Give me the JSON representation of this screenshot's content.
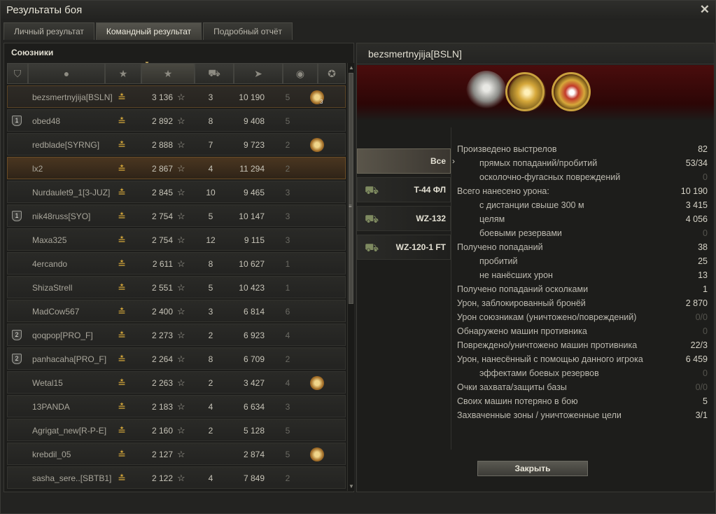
{
  "window": {
    "title": "Результаты боя"
  },
  "tabs": [
    {
      "label": "Личный результат"
    },
    {
      "label": "Командный результат"
    },
    {
      "label": "Подробный отчёт"
    }
  ],
  "left_panel": {
    "title": "Союзники",
    "columns": [
      "platoon-icon",
      "player-icon",
      "rank-icon",
      "xp-star-icon",
      "frags-tank-icon",
      "damage-gun-icon",
      "capture-icon",
      "medal-icon"
    ],
    "rows": [
      {
        "name": "bezsmertnyjija[BSLN]",
        "xp": "3 136",
        "kills": "3",
        "damage": "10 190",
        "cap": "5",
        "medal": true,
        "medal_count": "3",
        "platoon": "",
        "style": "me"
      },
      {
        "name": "obed48",
        "xp": "2 892",
        "kills": "8",
        "damage": "9 408",
        "cap": "5",
        "medal": false,
        "platoon": "1",
        "style": ""
      },
      {
        "name": "redblade[SYRNG]",
        "xp": "2 888",
        "kills": "7",
        "damage": "9 723",
        "cap": "2",
        "medal": true,
        "platoon": "",
        "style": ""
      },
      {
        "name": "lx2",
        "xp": "2 867",
        "kills": "4",
        "damage": "11 294",
        "cap": "2",
        "medal": false,
        "platoon": "",
        "style": "hl"
      },
      {
        "name": "Nurdaulet9_1[3-JUZ]",
        "xp": "2 845",
        "kills": "10",
        "damage": "9 465",
        "cap": "3",
        "medal": false,
        "platoon": "",
        "style": ""
      },
      {
        "name": "nik48russ[SYO]",
        "xp": "2 754",
        "kills": "5",
        "damage": "10 147",
        "cap": "3",
        "medal": false,
        "platoon": "1",
        "style": ""
      },
      {
        "name": "Maxa325",
        "xp": "2 754",
        "kills": "12",
        "damage": "9 115",
        "cap": "3",
        "medal": false,
        "platoon": "",
        "style": ""
      },
      {
        "name": "4ercando",
        "xp": "2 611",
        "kills": "8",
        "damage": "10 627",
        "cap": "1",
        "medal": false,
        "platoon": "",
        "style": ""
      },
      {
        "name": "ShizaStrell",
        "xp": "2 551",
        "kills": "5",
        "damage": "10 423",
        "cap": "1",
        "medal": false,
        "platoon": "",
        "style": ""
      },
      {
        "name": "MadCow567",
        "xp": "2 400",
        "kills": "3",
        "damage": "6 814",
        "cap": "6",
        "medal": false,
        "platoon": "",
        "style": ""
      },
      {
        "name": "qoqpop[PRO_F]",
        "xp": "2 273",
        "kills": "2",
        "damage": "6 923",
        "cap": "4",
        "medal": false,
        "platoon": "2",
        "style": ""
      },
      {
        "name": "panhacaha[PRO_F]",
        "xp": "2 264",
        "kills": "8",
        "damage": "6 709",
        "cap": "2",
        "medal": false,
        "platoon": "2",
        "style": ""
      },
      {
        "name": "Wetal15",
        "xp": "2 263",
        "kills": "2",
        "damage": "3 427",
        "cap": "4",
        "medal": true,
        "platoon": "",
        "style": ""
      },
      {
        "name": "13PANDA",
        "xp": "2 183",
        "kills": "4",
        "damage": "6 634",
        "cap": "3",
        "medal": false,
        "platoon": "",
        "style": ""
      },
      {
        "name": "Agrigat_new[R-P-E]",
        "xp": "2 160",
        "kills": "2",
        "damage": "5 128",
        "cap": "5",
        "medal": false,
        "platoon": "",
        "style": ""
      },
      {
        "name": "krebdil_05",
        "xp": "2 127",
        "kills": "",
        "damage": "2 874",
        "cap": "5",
        "medal": true,
        "platoon": "",
        "style": ""
      },
      {
        "name": "sasha_sere..[SBTB1]",
        "xp": "2 122",
        "kills": "4",
        "damage": "7 849",
        "cap": "2",
        "medal": false,
        "platoon": "",
        "style": ""
      }
    ]
  },
  "right_panel": {
    "player_name": "bezsmertnyjija[BSLN]",
    "tanks": [
      {
        "label": "Все",
        "active": true
      },
      {
        "label": "T-44 ФЛ",
        "active": false
      },
      {
        "label": "WZ-132",
        "active": false
      },
      {
        "label": "WZ-120-1 FT",
        "active": false
      }
    ],
    "stats": [
      {
        "label": "Произведено выстрелов",
        "value": "82",
        "sub": false,
        "dim": false
      },
      {
        "label": "прямых попаданий/пробитий",
        "value": "53/34",
        "sub": true,
        "dim": false
      },
      {
        "label": "осколочно-фугасных повреждений",
        "value": "0",
        "sub": true,
        "dim": true
      },
      {
        "label": "Всего нанесено урона:",
        "value": "10 190",
        "sub": false,
        "dim": false
      },
      {
        "label": "с дистанции свыше 300 м",
        "value": "3 415",
        "sub": true,
        "dim": false
      },
      {
        "label": "целям",
        "value": "4 056",
        "sub": true,
        "dim": false
      },
      {
        "label": "боевыми резервами",
        "value": "0",
        "sub": true,
        "dim": true
      },
      {
        "label": "Получено попаданий",
        "value": "38",
        "sub": false,
        "dim": false
      },
      {
        "label": "пробитий",
        "value": "25",
        "sub": true,
        "dim": false
      },
      {
        "label": "не нанёсших урон",
        "value": "13",
        "sub": true,
        "dim": false
      },
      {
        "label": "Получено попаданий осколками",
        "value": "1",
        "sub": false,
        "dim": false
      },
      {
        "label": "Урон, заблокированный бронёй",
        "value": "2 870",
        "sub": false,
        "dim": false
      },
      {
        "label": "Урон союзникам (уничтожено/повреждений)",
        "value": "0/0",
        "sub": false,
        "dim": true
      },
      {
        "label": "Обнаружено машин противника",
        "value": "0",
        "sub": false,
        "dim": true
      },
      {
        "label": "Повреждено/уничтожено машин противника",
        "value": "22/3",
        "sub": false,
        "dim": false
      },
      {
        "label": "Урон, нанесённый с помощью данного игрока",
        "value": "6 459",
        "sub": false,
        "dim": false
      },
      {
        "label": "эффектами боевых резервов",
        "value": "0",
        "sub": true,
        "dim": true
      },
      {
        "label": "Очки захвата/защиты базы",
        "value": "0/0",
        "sub": false,
        "dim": true
      },
      {
        "label": "Своих машин потеряно в бою",
        "value": "5",
        "sub": false,
        "dim": false
      },
      {
        "label": "Захваченные зоны / уничтоженные цели",
        "value": "3/1",
        "sub": false,
        "dim": false
      }
    ],
    "close_label": "Закрыть"
  }
}
